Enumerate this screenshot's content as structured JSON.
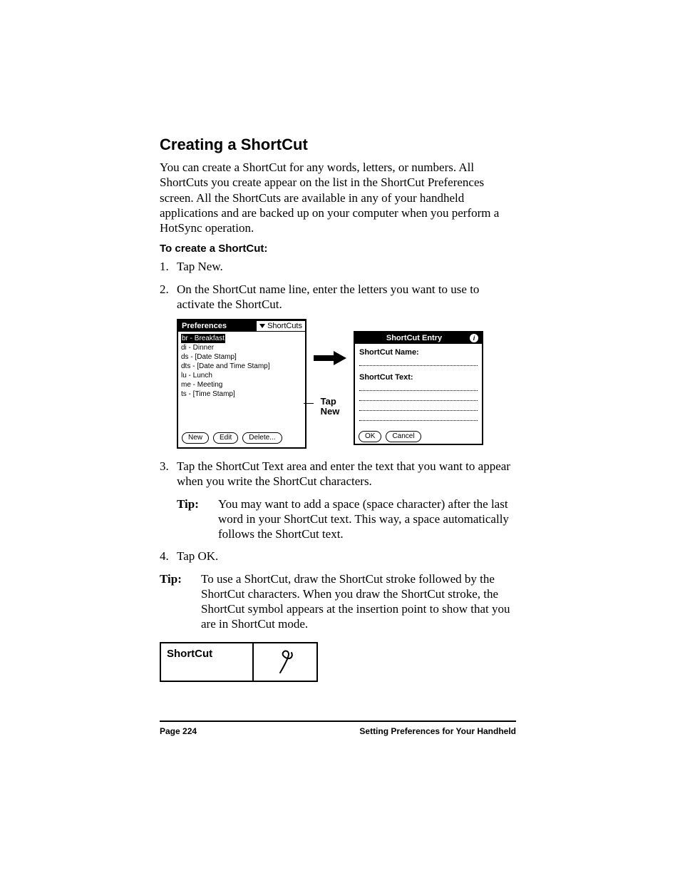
{
  "heading": "Creating a ShortCut",
  "intro": "You can create a ShortCut for any words, letters, or numbers. All ShortCuts you create appear on the list in the ShortCut Preferences screen. All the ShortCuts are available in any of your handheld applications and are backed up on your computer when you perform a HotSync operation.",
  "subheading": "To create a ShortCut:",
  "steps": {
    "s1": "Tap New.",
    "s2": "On the ShortCut name line, enter the letters you want to use to activate the ShortCut.",
    "s3": "Tap the ShortCut Text area and enter the text that you want to appear when you write the ShortCut characters.",
    "s4": "Tap OK."
  },
  "tip_label": "Tip:",
  "tip_inner": "You may want to add a space (space character) after the last word in your ShortCut text. This way, a space automatically follows the ShortCut text.",
  "tip_outer": "To use a ShortCut, draw the ShortCut stroke followed by the ShortCut characters. When you draw the ShortCut stroke, the ShortCut symbol appears at the insertion point to show that you are in ShortCut mode.",
  "screen1": {
    "title_left": "Preferences",
    "title_right": "ShortCuts",
    "items": [
      "br - Breakfast",
      "di - Dinner",
      "ds - [Date Stamp]",
      "dts - [Date and Time Stamp]",
      "lu - Lunch",
      "me - Meeting",
      "ts - [Time Stamp]"
    ],
    "btn_new": "New",
    "btn_edit": "Edit",
    "btn_delete": "Delete..."
  },
  "arrow_caption_l1": "Tap",
  "arrow_caption_l2": "New",
  "screen2": {
    "title": "ShortCut Entry",
    "name_label": "ShortCut Name:",
    "text_label": "ShortCut Text:",
    "btn_ok": "OK",
    "btn_cancel": "Cancel"
  },
  "shortcut_box_label": "ShortCut",
  "footer_left": "Page 224",
  "footer_right": "Setting Preferences for Your Handheld"
}
